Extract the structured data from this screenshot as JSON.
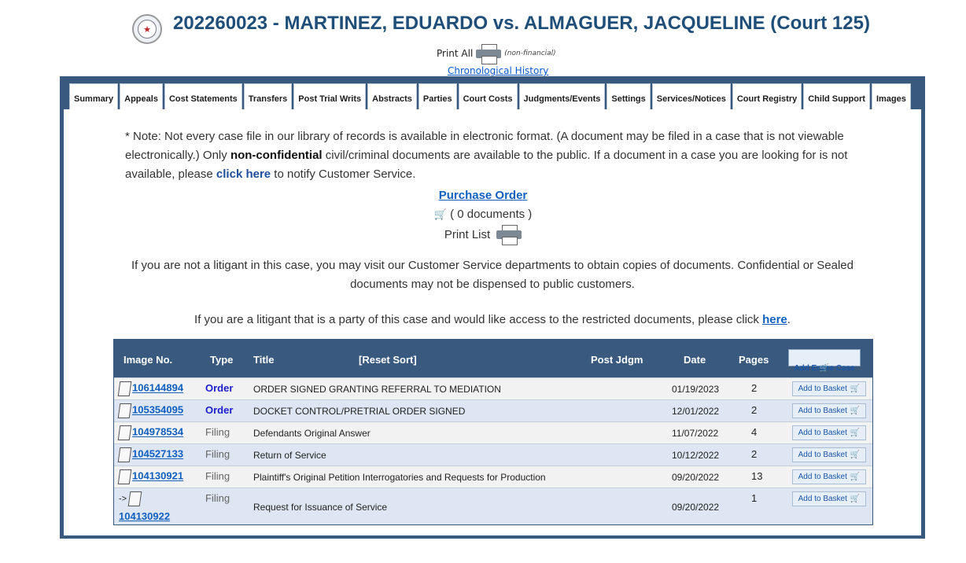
{
  "header": {
    "case_title": "202260023 - MARTINEZ, EDUARDO vs. ALMAGUER, JACQUELINE (Court 125)",
    "print_all_label": "Print All",
    "non_financial": "(non-financial)",
    "chronological_history": "Chronological History",
    "seal_icon": "county-seal-icon"
  },
  "tabs": [
    {
      "label": "Summary"
    },
    {
      "label": "Appeals"
    },
    {
      "label": "Cost Statements"
    },
    {
      "label": "Transfers"
    },
    {
      "label": "Post Trial Writs"
    },
    {
      "label": "Abstracts"
    },
    {
      "label": "Parties"
    },
    {
      "label": "Court Costs"
    },
    {
      "label": "Judgments/Events"
    },
    {
      "label": "Settings"
    },
    {
      "label": "Services/Notices"
    },
    {
      "label": "Court Registry"
    },
    {
      "label": "Child Support"
    },
    {
      "label": "Images",
      "active": true
    }
  ],
  "note": {
    "part1": "* Note: Not every case file in our library of records is available in electronic format. (A document may be filed in a case that is not viewable electronically.) Only ",
    "bold": "non-confidential",
    "part2": " civil/criminal documents are available to the public. If a document in a case you are looking for is not available, please ",
    "link": "click here",
    "part3": " to notify Customer Service."
  },
  "purchase": {
    "link": "Purchase Order",
    "docs": "( 0 documents )",
    "print_list": "Print List"
  },
  "visit_text": "If you are not a litigant in this case, you may visit our Customer Service departments to obtain copies of documents. Confidential or Sealed documents may not be dispensed to public customers.",
  "litigant": {
    "text": "If you are a litigant that is a party of this case and would like access to the restricted documents, please click ",
    "link": "here",
    "end": "."
  },
  "table": {
    "headers": {
      "image_no": "Image No.",
      "type": "Type",
      "title": "Title",
      "reset": "[Reset Sort]",
      "post_jdgm": "Post Jdgm",
      "date": "Date",
      "pages": "Pages",
      "add_entire": "Add Entire Case"
    },
    "add_basket": "Add to Basket",
    "rows": [
      {
        "image_no": "106144894",
        "type": "Order",
        "title": "ORDER SIGNED GRANTING REFERRAL TO MEDIATION",
        "date": "01/19/2023",
        "pages": "2"
      },
      {
        "image_no": "105354095",
        "type": "Order",
        "title": "DOCKET CONTROL/PRETRIAL ORDER SIGNED",
        "date": "12/01/2022",
        "pages": "2"
      },
      {
        "image_no": "104978534",
        "type": "Filing",
        "title": "Defendants Original Answer",
        "date": "11/07/2022",
        "pages": "4"
      },
      {
        "image_no": "104527133",
        "type": "Filing",
        "title": "Return of Service",
        "date": "10/12/2022",
        "pages": "2"
      },
      {
        "image_no": "104130921",
        "type": "Filing",
        "title": "Plaintiff's Original Petition Interrogatories and Requests for Production",
        "date": "09/20/2022",
        "pages": "13"
      },
      {
        "image_no": "104130922",
        "type": "Filing",
        "title": "Request for Issuance of Service",
        "date": "09/20/2022",
        "pages": "1",
        "prefix": "->"
      }
    ]
  }
}
